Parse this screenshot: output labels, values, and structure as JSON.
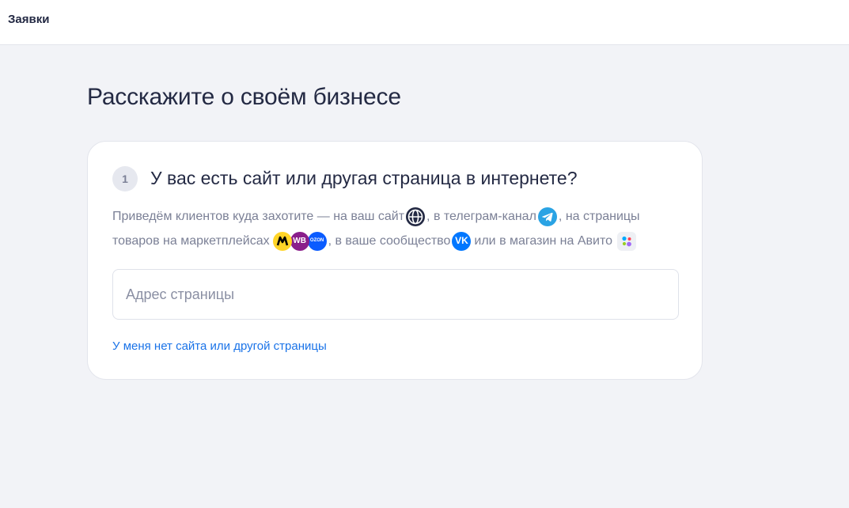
{
  "header": {
    "title": "Заявки"
  },
  "page": {
    "title": "Расскажите о своём бизнесе"
  },
  "step": {
    "number": "1",
    "question": "У вас есть сайт или другая страница в интернете?",
    "description": {
      "part1": "Приведём клиентов куда захотите — на ваш сайт",
      "part2": ", в телеграм-канал",
      "part3": ", на страницы",
      "part4": "товаров на маркетплейсах",
      "part5": ", в ваше сообщество",
      "part6": "или в магазин на Авито"
    },
    "icons": {
      "website": "globe-icon",
      "telegram": "telegram-icon",
      "yandex_market": "yandex-market-icon",
      "wildberries": "wildberries-icon",
      "wildberries_text": "WB",
      "ozon": "ozon-icon",
      "ozon_text": "OZON",
      "vk": "vk-icon",
      "vk_text": "VK",
      "avito": "avito-icon"
    },
    "input": {
      "placeholder": "Адрес страницы",
      "value": ""
    },
    "no_site_link": "У меня нет сайта или другой страницы"
  },
  "colors": {
    "background": "#f2f3f7",
    "text_primary": "#242a44",
    "text_secondary": "#7b8096",
    "link": "#1a73e8",
    "telegram": "#2aa3e4",
    "yandex_market": "#ffd427",
    "wildberries": "#8a1e8b",
    "ozon": "#0b5cff",
    "vk": "#0077ff"
  }
}
